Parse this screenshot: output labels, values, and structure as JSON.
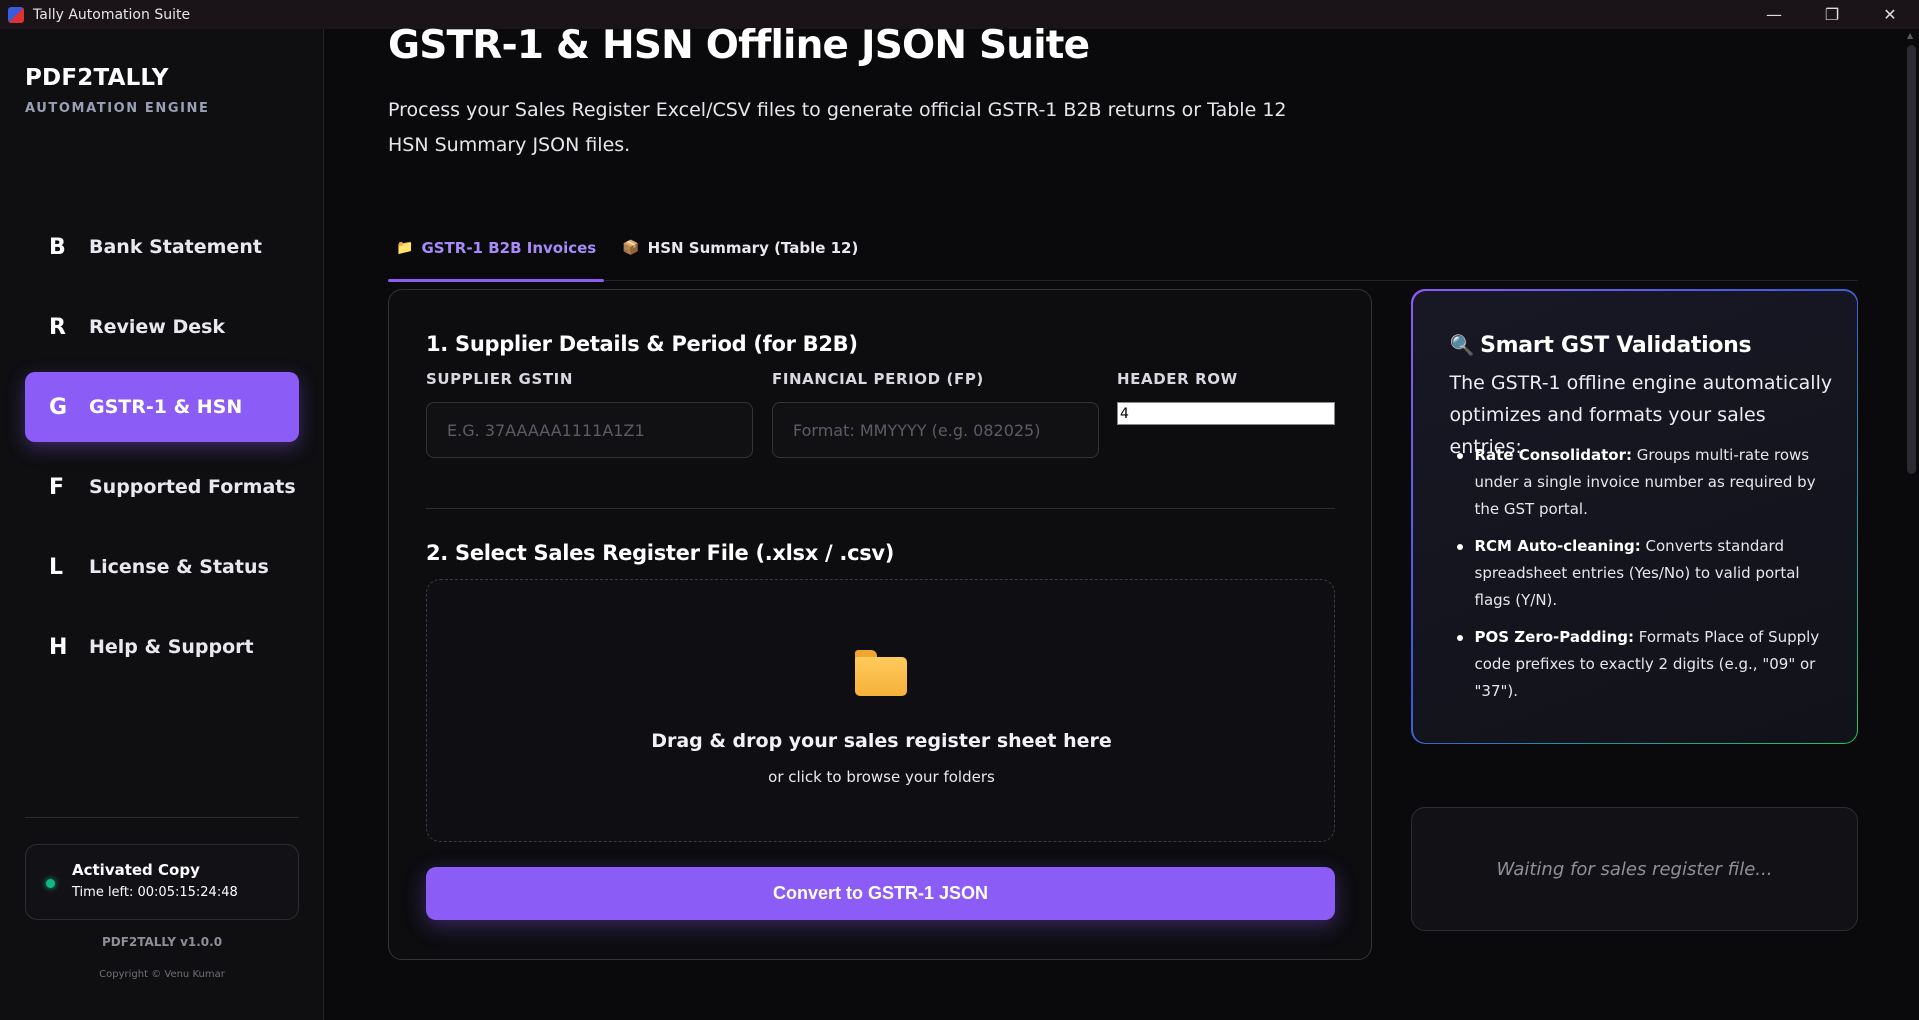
{
  "window": {
    "title": "Tally Automation Suite",
    "controls": {
      "minimize": "—",
      "restore": "❐",
      "close": "✕"
    }
  },
  "sidebar": {
    "brand": "PDF2TALLY",
    "brand_sub": "AUTOMATION ENGINE",
    "items": [
      {
        "letter": "B",
        "label": "Bank Statement",
        "active": false
      },
      {
        "letter": "R",
        "label": "Review Desk",
        "active": false
      },
      {
        "letter": "G",
        "label": "GSTR-1 & HSN",
        "active": true
      },
      {
        "letter": "F",
        "label": "Supported Formats",
        "active": false
      },
      {
        "letter": "L",
        "label": "License & Status",
        "active": false
      },
      {
        "letter": "H",
        "label": "Help & Support",
        "active": false
      }
    ],
    "license": {
      "status": "Activated Copy",
      "time_left": "Time left: 00:05:15:24:48",
      "status_color": "#10b981"
    },
    "version": "PDF2TALLY v1.0.0",
    "copyright": "Copyright © Venu Kumar"
  },
  "main": {
    "title": "GSTR-1 & HSN Offline JSON Suite",
    "description": "Process your Sales Register Excel/CSV files to generate official GSTR-1 B2B returns or Table 12 HSN Summary JSON files.",
    "tabs": [
      {
        "icon": "folder-icon",
        "label": "GSTR-1 B2B Invoices",
        "active": true
      },
      {
        "icon": "package-icon",
        "label": "HSN Summary (Table 12)",
        "active": false
      }
    ],
    "section1_title": "1. Supplier Details & Period (for B2B)",
    "fields": {
      "gstin_label": "SUPPLIER GSTIN",
      "gstin_placeholder": "E.G. 37AAAAA1111A1Z1",
      "fp_label": "FINANCIAL PERIOD (FP)",
      "fp_placeholder": "Format: MMYYYY (e.g. 082025)",
      "header_row_label": "HEADER ROW",
      "header_row_value": "4"
    },
    "section2_title": "2. Select Sales Register File (.xlsx / .csv)",
    "dropzone": {
      "main_text": "Drag & drop your sales register sheet here",
      "sub_text": "or click to browse your folders"
    },
    "convert_button": "Convert to GSTR-1 JSON"
  },
  "validations": {
    "title": "Smart GST Validations",
    "intro": "The GSTR-1 offline engine automatically optimizes and formats your sales entries:",
    "items": [
      {
        "bold": "Rate Consolidator:",
        "text": " Groups multi-rate rows under a single invoice number as required by the GST portal."
      },
      {
        "bold": "RCM Auto-cleaning:",
        "text": " Converts standard spreadsheet entries (Yes/No) to valid portal flags (Y/N)."
      },
      {
        "bold": "POS Zero-Padding:",
        "text": " Formats Place of Supply code prefixes to exactly 2 digits (e.g., \"09\" or \"37\")."
      }
    ]
  },
  "status": {
    "message": "Waiting for sales register file..."
  },
  "colors": {
    "accent": "#8b5cf6",
    "background": "#0a0a0c",
    "success": "#10b981"
  }
}
